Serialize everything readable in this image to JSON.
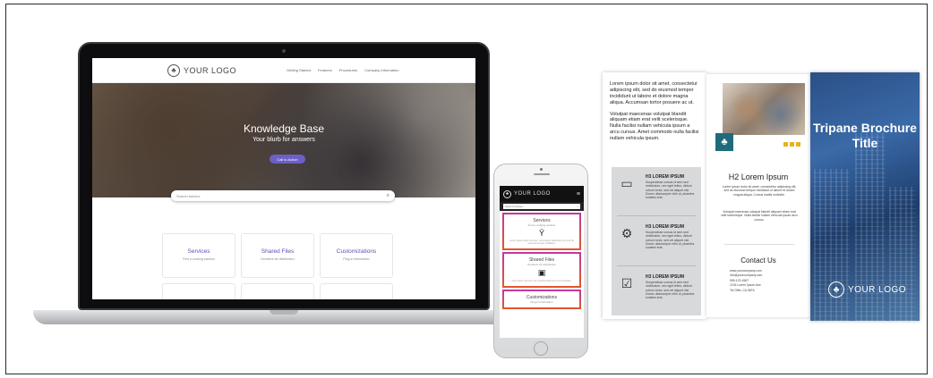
{
  "logo": {
    "text": "YOUR LOGO",
    "mark": "♣"
  },
  "website": {
    "nav_links": [
      "Getting Started",
      "Features",
      "Procedures",
      "Company Information"
    ],
    "hero_title": "Knowledge Base",
    "hero_subtitle": "Your blurb for answers",
    "hero_button": "Call to Action",
    "search_placeholder": "Search articles",
    "cards": [
      {
        "title": "Services",
        "sub": "Find a cooking solution"
      },
      {
        "title": "Shared Files",
        "sub": "Numbers for distribution"
      },
      {
        "title": "Customizations",
        "sub": "Plug-in information"
      }
    ]
  },
  "phone": {
    "search_placeholder": "Search articles",
    "cards": [
      {
        "title": "Services",
        "sub": "Find a cooking solution",
        "icon": "Ÿ",
        "body": "Lorem ipsum dolor sit amet, consectetur adipiscing elit, sed do eiusmod tempor incididunt."
      },
      {
        "title": "Shared Files",
        "sub": "Numbers for distribution",
        "icon": "▣",
        "body": "Quis autem vel eum iure reprehenderit qui in ea voluptate."
      },
      {
        "title": "Customizations",
        "sub": "Plug-in information",
        "icon": "",
        "body": ""
      }
    ]
  },
  "brochure": {
    "left_para1": "Lorem ipsum dolor sit amet, consectetur adipiscing elit, sed do eiusmod tempor incididunt ut labore et dolore magna aliqua. Accumsan tortor posuere ac ut.",
    "left_para2": "Volutpat maecenas volutpat blandit aliquam etiam erat velit scelerisque. Nulla facilisi nullam vehicula ipsum a arcu cursus. Amet commodo nulla facilisi nullam vehicula ipsum.",
    "rows": [
      {
        "heading": "H3 LOREM IPSUM",
        "icon": "▭"
      },
      {
        "heading": "H3 LOREM IPSUM",
        "icon": "⚙"
      },
      {
        "heading": "H3 LOREM IPSUM",
        "icon": "☑"
      }
    ],
    "row_body": "Suspendisse cursus id sem sed vestibulum, nec eget tellus, dictum rutrum tortor, sed vel aliquet nisl. Donec ullamcorper nibh ut, pharetra sodales erat.",
    "h2": "H2 Lorem Ipsum",
    "mid_para1": "Lorem ipsum dolor sit amet, consectetur adipiscing elit, sed do eiusmod tempor incididunt ut labore et dolore magna aliqua. Cursus mattis molestie.",
    "mid_para2": "Volutpat maecenas volutpat blandit aliquam etiam erat velit scelerisque. Nulla facilisi nullam vehicula ipsum arcu cursus.",
    "contact_heading": "Contact Us",
    "contact_lines": [
      "www.yourcompany.com",
      "info@yourcompany.com",
      "555-123-4567",
      "1234 Lorem Ipsum Ave",
      "Tel Offer, CA 9876"
    ],
    "cover_title": "Tripane Brochure Title"
  },
  "colors": {
    "accent": "#6c5fc7",
    "teal": "#1f6b7a",
    "gold": "#e6b21f",
    "navy": "#2c4f86"
  }
}
